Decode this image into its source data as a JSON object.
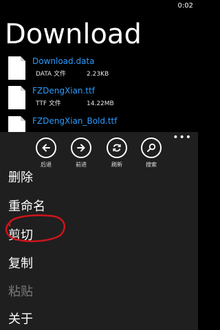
{
  "status_bar": {
    "time": "0:02"
  },
  "page": {
    "title": "Download"
  },
  "files": [
    {
      "name": "Download.data",
      "type": "DATA 文件",
      "size": "2.23KB"
    },
    {
      "name": "FZDengXian.ttf",
      "type": "TTF 文件",
      "size": "14.22MB"
    },
    {
      "name": "FZDengXian_Bold.ttf",
      "type": "",
      "size": ""
    }
  ],
  "app_bar": {
    "buttons": [
      {
        "label": "后退",
        "icon": "back-arrow-icon"
      },
      {
        "label": "前进",
        "icon": "forward-arrow-icon"
      },
      {
        "label": "刷新",
        "icon": "refresh-icon"
      },
      {
        "label": "搜索",
        "icon": "search-icon"
      }
    ],
    "more": "•••"
  },
  "menu": {
    "items": [
      {
        "label": "删除",
        "enabled": true
      },
      {
        "label": "重命名",
        "enabled": true
      },
      {
        "label": "剪切",
        "enabled": true
      },
      {
        "label": "复制",
        "enabled": true
      },
      {
        "label": "粘贴",
        "enabled": false
      },
      {
        "label": "关于",
        "enabled": true
      }
    ]
  },
  "colors": {
    "background": "#000000",
    "app_bar": "#1f1f1f",
    "file_name": "#2b9cff",
    "disabled_text": "#7a7a7a",
    "annotation": "#d0141c"
  }
}
